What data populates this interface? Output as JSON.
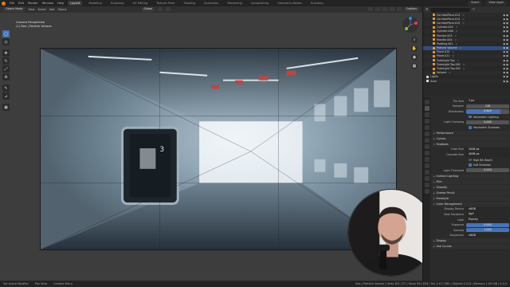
{
  "menu": {
    "items": [
      "File",
      "Edit",
      "Render",
      "Window",
      "Help"
    ],
    "workspaces": [
      "Layout",
      "Modeling",
      "Sculpting",
      "UV Editing",
      "Texture Paint",
      "Shading",
      "Animation",
      "Rendering",
      "Compositing",
      "Geometry Nodes",
      "Scripting"
    ],
    "active_workspace": "Layout",
    "scene": "Scene",
    "view_layer": "View Layer"
  },
  "viewport_header": {
    "mode": "Object Mode",
    "menus": [
      "View",
      "Select",
      "Add",
      "Object"
    ],
    "orientation": "Global",
    "options": "Options"
  },
  "viewport": {
    "camera_label": "Camera Perspective",
    "collection_label": "(1) Dee | Particle Volume",
    "gizmo_axes": [
      "X",
      "Y",
      "Z"
    ]
  },
  "toolbar": {
    "tools": [
      "select-tool",
      "cursor-tool",
      "move-tool",
      "rotate-tool",
      "scale-tool",
      "transform-tool",
      "annotate-tool",
      "measure-tool",
      "add-cube-tool"
    ]
  },
  "outliner": {
    "rows": [
      {
        "label": "CorridorPiece.013",
        "type": "obj"
      },
      {
        "label": "CorridorPiece.014",
        "type": "obj"
      },
      {
        "label": "CorridorPiece.015",
        "type": "obj"
      },
      {
        "label": "Cylinder.005",
        "type": "obj"
      },
      {
        "label": "Cylinder.006",
        "type": "obj"
      },
      {
        "label": "Monitor.003",
        "type": "obj"
      },
      {
        "label": "Monitor.004",
        "type": "obj"
      },
      {
        "label": "Padding.001",
        "type": "obj"
      },
      {
        "label": "Particle Volume",
        "type": "obj",
        "selected": true
      },
      {
        "label": "Plane.010",
        "type": "obj"
      },
      {
        "label": "Plane.011",
        "type": "obj"
      },
      {
        "label": "TubeLight Top",
        "type": "obj"
      },
      {
        "label": "TubeLight Top.001",
        "type": "obj"
      },
      {
        "label": "TubeLight Top.002",
        "type": "obj"
      },
      {
        "label": "Volume",
        "type": "obj"
      },
      {
        "label": "Lights",
        "type": "col",
        "top": true
      },
      {
        "label": "Scan",
        "type": "col",
        "top": true
      }
    ]
  },
  "properties": {
    "top_rows": [
      {
        "label": "Tile Size",
        "value": "2 px",
        "kind": "dd"
      },
      {
        "label": "Samples",
        "value": "128",
        "kind": "num"
      },
      {
        "label": "Distribution",
        "value": "0.800",
        "kind": "slider",
        "fill": 0.8
      }
    ],
    "volumetric_lighting": {
      "label": "Volumetric Lighting",
      "checked": true
    },
    "light_clamping": {
      "label": "Light Clamping",
      "value": "0.000"
    },
    "volumetric_shadows": {
      "label": "Volumetric Shadows",
      "checked": true
    },
    "sections_a": [
      "Performance",
      "Curves"
    ],
    "shadows_section": "Shadows",
    "shadows": {
      "cube_size": {
        "label": "Cube Size",
        "value": "2048 px"
      },
      "cascade_size": {
        "label": "Cascade Size",
        "value": "4096 px"
      },
      "high_bit_depth": {
        "label": "High Bit Depth",
        "checked": false
      },
      "soft_shadows": {
        "label": "Soft Shadows",
        "checked": true
      },
      "light_threshold": {
        "label": "Light Threshold",
        "value": "0.010"
      }
    },
    "sections_b": [
      "Indirect Lighting",
      "Film",
      "Simplify",
      "Grease Pencil",
      "Freestyle"
    ],
    "color_management_section": "Color Management",
    "color_management": {
      "display_device": {
        "label": "Display Device",
        "value": "sRGB"
      },
      "view_transform": {
        "label": "View Transform",
        "value": "AgX"
      },
      "look": {
        "label": "Look",
        "value": "Punchy"
      },
      "exposure": {
        "label": "Exposure",
        "value": "0.000"
      },
      "gamma": {
        "label": "Gamma",
        "value": "1.000"
      },
      "sequencer": {
        "label": "Sequencer",
        "value": "sRGB"
      }
    },
    "sections_c": [
      "Display",
      "Use Curves"
    ]
  },
  "statusbar": {
    "items": [
      "Set Active Modifier",
      "Pan View",
      "Context Menu"
    ],
    "stats": "Dee | Particle Volume | Verts 461,727 | Faces 991,834 | Tris 1,517,360 | Objects 1/123 | Memory 1.09 GiB | 4.0.0"
  },
  "colors": {
    "accent": "#4772b3",
    "selection": "#334d80",
    "object_icon": "#e49b3c",
    "blender_logo": "#e87d0d"
  }
}
